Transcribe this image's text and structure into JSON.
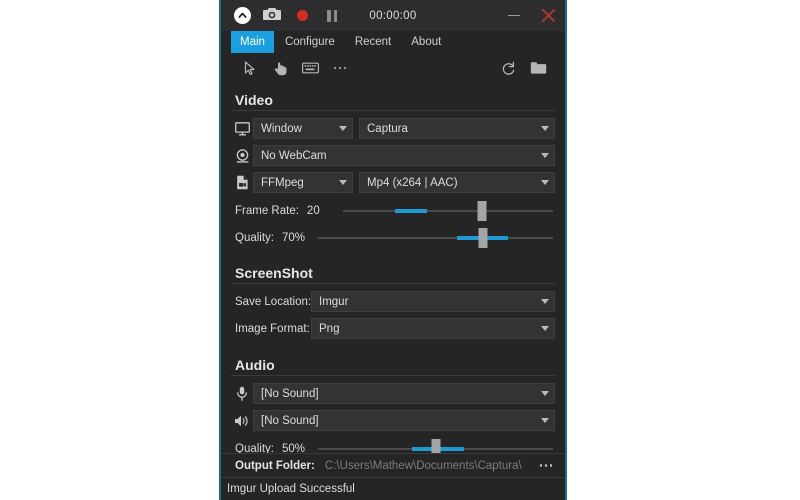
{
  "titlebar": {
    "icons": [
      "chevron-up-icon",
      "camera-icon",
      "record-icon",
      "pause-icon"
    ],
    "timer": "00:00:00",
    "minimize_label": "",
    "close_label": ""
  },
  "tabs": [
    {
      "label": "Main",
      "active": true
    },
    {
      "label": "Configure",
      "active": false
    },
    {
      "label": "Recent",
      "active": false
    },
    {
      "label": "About",
      "active": false
    }
  ],
  "toolbar": {
    "left_icons": [
      "cursor-icon",
      "click-icon",
      "keyboard-icon",
      "ellipsis-icon"
    ],
    "right_icons": [
      "refresh-icon",
      "folder-icon"
    ]
  },
  "video": {
    "title": "Video",
    "source_type": "Window",
    "source_target": "Captura",
    "webcam": "No WebCam",
    "encoder": "FFMpeg",
    "format": "Mp4 (x264 | AAC)",
    "frame_rate_label": "Frame Rate:",
    "frame_rate_value": "20",
    "quality_label": "Quality:",
    "quality_value": "70%"
  },
  "screenshot": {
    "title": "ScreenShot",
    "save_location_label": "Save Location:",
    "save_location_value": "Imgur",
    "image_format_label": "Image Format:",
    "image_format_value": "Png"
  },
  "audio": {
    "title": "Audio",
    "microphone": "[No Sound]",
    "speaker": "[No Sound]",
    "quality_label": "Quality:",
    "quality_value": "50%"
  },
  "output": {
    "label": "Output Folder:",
    "path": "C:\\Users\\Mathew\\Documents\\Captura\\",
    "more_icon": "ellipsis-icon"
  },
  "status": {
    "message": "Imgur Upload Successful"
  },
  "colors": {
    "accent": "#1b9fe0",
    "slider_fill": "#1f9ad6",
    "record": "#d82b20",
    "close": "#a43a34",
    "window_bg": "#252526",
    "titlebar_bg": "#2d2d30",
    "border": "#1c6a8e"
  }
}
